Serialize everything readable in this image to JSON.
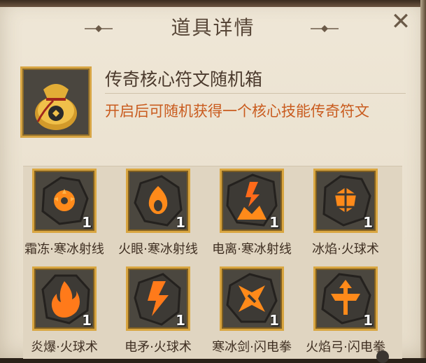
{
  "dialog": {
    "title": "道具详情",
    "close_icon": "close-icon"
  },
  "item": {
    "name": "传奇核心符文随机箱",
    "description": "开启后可随机获得一个核心技能传奇符文",
    "icon": "loot-bag-icon"
  },
  "rewards": [
    {
      "label": "霜冻·寒冰射线",
      "count": "1",
      "icon": "frost-rune-icon"
    },
    {
      "label": "火眼·寒冰射线",
      "count": "1",
      "icon": "fire-eye-rune-icon"
    },
    {
      "label": "电离·寒冰射线",
      "count": "1",
      "icon": "lightning-burst-rune-icon"
    },
    {
      "label": "冰焰·火球术",
      "count": "1",
      "icon": "ice-flame-rune-icon"
    },
    {
      "label": "炎爆·火球术",
      "count": "1",
      "icon": "flame-burst-rune-icon"
    },
    {
      "label": "电矛·火球术",
      "count": "1",
      "icon": "lightning-spear-rune-icon"
    },
    {
      "label": "寒冰剑·闪电拳",
      "count": "1",
      "icon": "ice-sword-rune-icon"
    },
    {
      "label": "火焰弓·闪电拳",
      "count": "1",
      "icon": "fire-bow-rune-icon"
    }
  ],
  "colors": {
    "panel": "#efe7d7",
    "gold_border": "#d9a640",
    "description": "#c95b1e",
    "rune_glow": "#ff8a1a"
  }
}
